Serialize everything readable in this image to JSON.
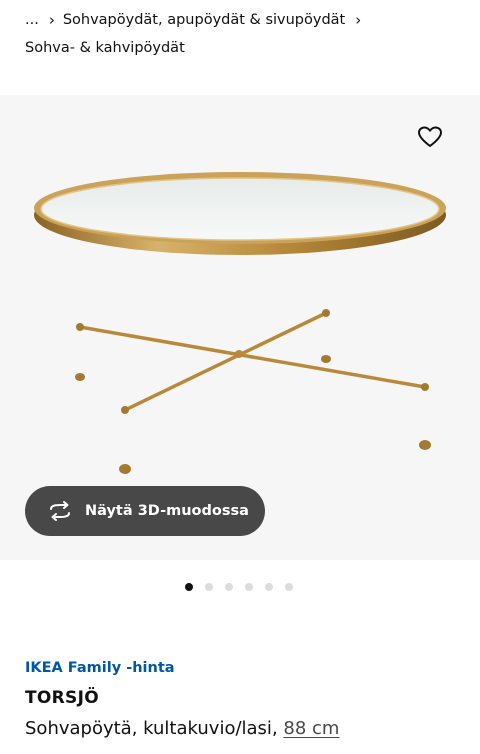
{
  "breadcrumb": {
    "ellipsis": "...",
    "level1": "Sohvapöydät, apupöydät & sivupöydät",
    "level2": "Sohva- & kahvipöydät"
  },
  "product": {
    "family_price_label": "IKEA Family -hinta",
    "name": "TORSJÖ",
    "description": "Sohvapöytä, kultakuvio/lasi, ",
    "size_link": "88 cm"
  },
  "gallery": {
    "view_3d_label": "Näytä 3D-muodossa",
    "image_count": 6,
    "active_index": 0
  },
  "icons": {
    "favorite": "heart-icon",
    "rotate": "rotate-3d-icon",
    "chevron": "chevron-right-icon"
  },
  "colors": {
    "family_blue": "#0058a3",
    "button_bg": "#484848",
    "brass": "#b8893a"
  }
}
